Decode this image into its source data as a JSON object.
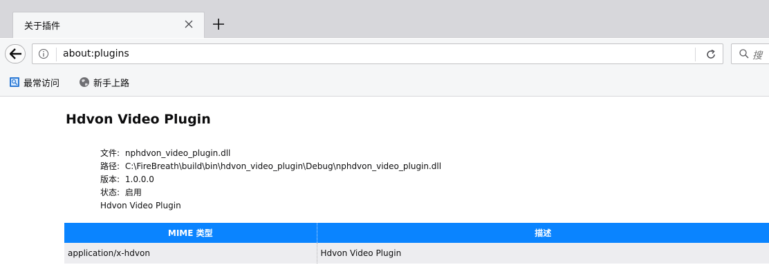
{
  "tab": {
    "title": "关于插件"
  },
  "navbar": {
    "url": "about:plugins",
    "search_placeholder": "搜"
  },
  "bookmarks": [
    {
      "label": "最常访问",
      "icon": "most-visited-icon"
    },
    {
      "label": "新手上路",
      "icon": "globe-icon"
    }
  ],
  "plugin": {
    "name": "Hdvon Video Plugin",
    "file_label": "文件:",
    "file_value": "nphdvon_video_plugin.dll",
    "path_label": "路径:",
    "path_value": "C:\\FireBreath\\build\\bin\\hdvon_video_plugin\\Debug\\nphdvon_video_plugin.dll",
    "version_label": "版本:",
    "version_value": "1.0.0.0",
    "state_label": "状态:",
    "state_value": "启用",
    "description": "Hdvon Video Plugin"
  },
  "mime_table": {
    "headers": [
      "MIME 类型",
      "描述"
    ],
    "rows": [
      [
        "application/x-hdvon",
        "Hdvon Video Plugin"
      ]
    ]
  },
  "colors": {
    "accent": "#0a84ff",
    "toolbar": "#f5f6f7",
    "tabstrip": "#d7d7db",
    "row": "#ededf0"
  }
}
